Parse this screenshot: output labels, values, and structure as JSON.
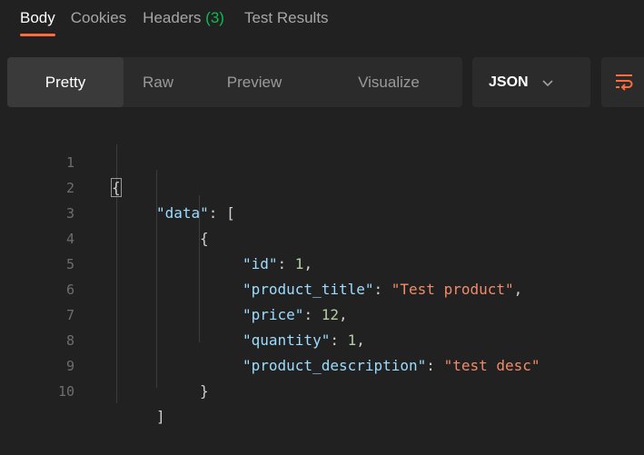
{
  "tabs": {
    "body": "Body",
    "cookies": "Cookies",
    "headers_label": "Headers",
    "headers_count": "(3)",
    "test_results": "Test Results"
  },
  "view_modes": {
    "pretty": "Pretty",
    "raw": "Raw",
    "preview": "Preview",
    "visualize": "Visualize"
  },
  "format": {
    "selected": "JSON"
  },
  "icons": {
    "format_dropdown": "chevron-down-icon",
    "wrap": "wrap-lines-icon"
  },
  "colors": {
    "active_tab_indicator": "#ff6c37",
    "headers_count": "#0cbb52",
    "json_key": "#9cdcfe",
    "json_string": "#f28b6b",
    "json_number": "#b5cea8"
  },
  "editor": {
    "line_numbers": [
      "1",
      "2",
      "3",
      "4",
      "5",
      "6",
      "7",
      "8",
      "9",
      "10"
    ],
    "lines": {
      "l1": "{",
      "l2_key": "\"data\"",
      "l2_rest": ": [",
      "l3": "{",
      "l4_key": "\"id\"",
      "l4_sep": ": ",
      "l4_val": "1",
      "l4_end": ",",
      "l5_key": "\"product_title\"",
      "l5_sep": ": ",
      "l5_val": "\"Test product\"",
      "l5_end": ",",
      "l6_key": "\"price\"",
      "l6_sep": ": ",
      "l6_val": "12",
      "l6_end": ",",
      "l7_key": "\"quantity\"",
      "l7_sep": ": ",
      "l7_val": "1",
      "l7_end": ",",
      "l8_key": "\"product_description\"",
      "l8_sep": ": ",
      "l8_val": "\"test desc\"",
      "l9": "}",
      "l10": "]"
    }
  }
}
